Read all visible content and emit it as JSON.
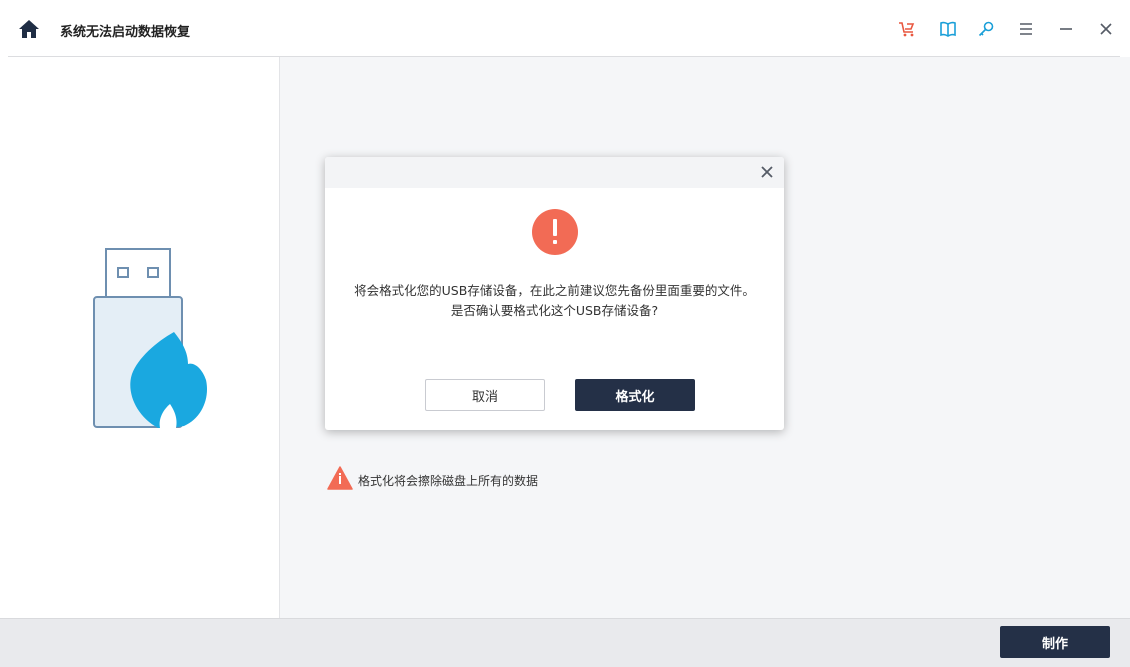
{
  "app": {
    "title": "系统无法启动数据恢复"
  },
  "toolbar": {
    "icons": [
      "home-icon",
      "cart-icon",
      "book-icon",
      "key-icon",
      "menu-icon",
      "minimize-icon",
      "close-icon"
    ]
  },
  "dialog": {
    "message": "将会格式化您的USB存储设备，在此之前建议您先备份里面重要的文件。是否确认要格式化这个USB存储设备?",
    "cancel_label": "取消",
    "confirm_label": "格式化"
  },
  "warning": {
    "text": "格式化将会擦除磁盘上所有的数据"
  },
  "footer": {
    "make_label": "制作"
  },
  "colors": {
    "accent": "#243047",
    "alert": "#f26b55",
    "usb_flame": "#1aa8e0",
    "cart_icon": "#e9573f",
    "tool_icon": "#1a9fd8"
  }
}
